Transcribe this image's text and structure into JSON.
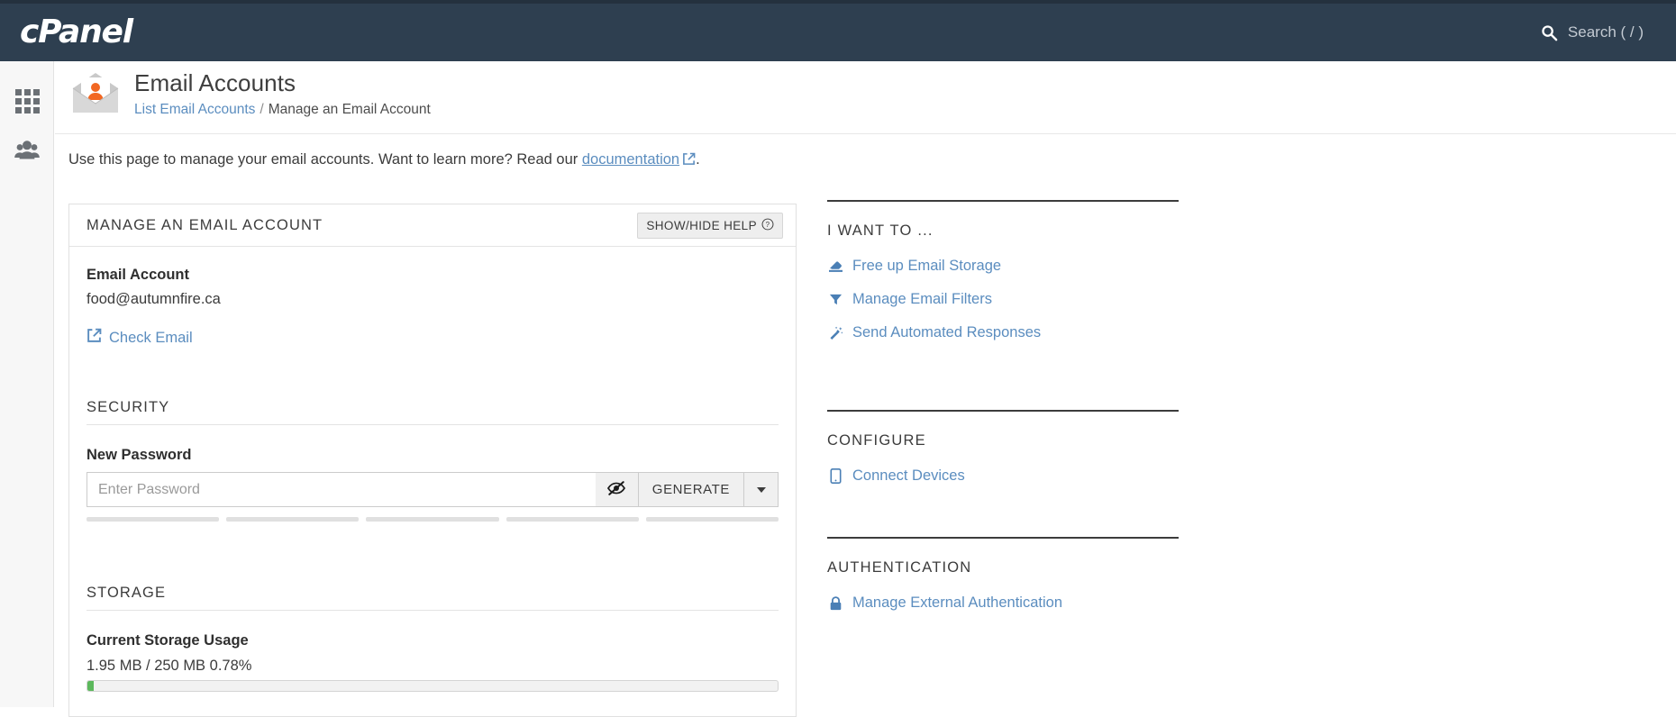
{
  "topbar": {
    "logo_text": "cPanel",
    "search_icon": "search-icon",
    "search_placeholder": "Search ( / )"
  },
  "sidebar": {
    "items": [
      {
        "icon": "grid-apps-icon",
        "label": "Tools"
      },
      {
        "icon": "users-group-icon",
        "label": "User Manager"
      }
    ]
  },
  "header": {
    "icon": "email-accounts-envelope-icon",
    "title": "Email Accounts",
    "breadcrumb": {
      "parent": "List Email Accounts",
      "separator": "/",
      "current": "Manage an Email Account"
    }
  },
  "intro": {
    "text_before": "Use this page to manage your email accounts. Want to learn more? Read our ",
    "link_text": "documentation",
    "link_icon": "external-link-icon",
    "text_after": "."
  },
  "card": {
    "title": "MANAGE AN EMAIL ACCOUNT",
    "help_button": {
      "label": "SHOW/HIDE HELP",
      "icon": "question-circle-icon"
    },
    "email_account": {
      "label": "Email Account",
      "value": "food@autumnfire.ca"
    },
    "check_email": {
      "label": "Check Email",
      "icon": "external-link-icon"
    },
    "security": {
      "title": "SECURITY",
      "password_label": "New Password",
      "password_value": "",
      "password_placeholder": "Enter Password",
      "toggle_icon": "eye-slash-icon",
      "generate_label": "GENERATE",
      "caret_icon": "chevron-down-icon",
      "strength_segments": 5,
      "strength_filled": 0
    },
    "storage": {
      "title": "STORAGE",
      "usage_label": "Current Storage Usage",
      "usage_value": "1.95 MB / 250 MB 0.78%",
      "used": "1.95 MB",
      "total": "250 MB",
      "percent": 0.78,
      "bar_color": "#5cb85c"
    }
  },
  "right_column": {
    "blocks": [
      {
        "title": "I WANT TO ...",
        "links": [
          {
            "label": "Free up Email Storage",
            "icon": "eraser-icon"
          },
          {
            "label": "Manage Email Filters",
            "icon": "filter-funnel-icon"
          },
          {
            "label": "Send Automated Responses",
            "icon": "magic-wand-icon"
          }
        ]
      },
      {
        "title": "CONFIGURE",
        "links": [
          {
            "label": "Connect Devices",
            "icon": "mobile-device-icon"
          }
        ]
      },
      {
        "title": "AUTHENTICATION",
        "links": [
          {
            "label": "Manage External Authentication",
            "icon": "lock-icon"
          }
        ]
      }
    ]
  },
  "colors": {
    "navbar": "#2e3f50",
    "link": "#5b8dbf",
    "accent_orange": "#f26722",
    "progress_green": "#5cb85c"
  }
}
